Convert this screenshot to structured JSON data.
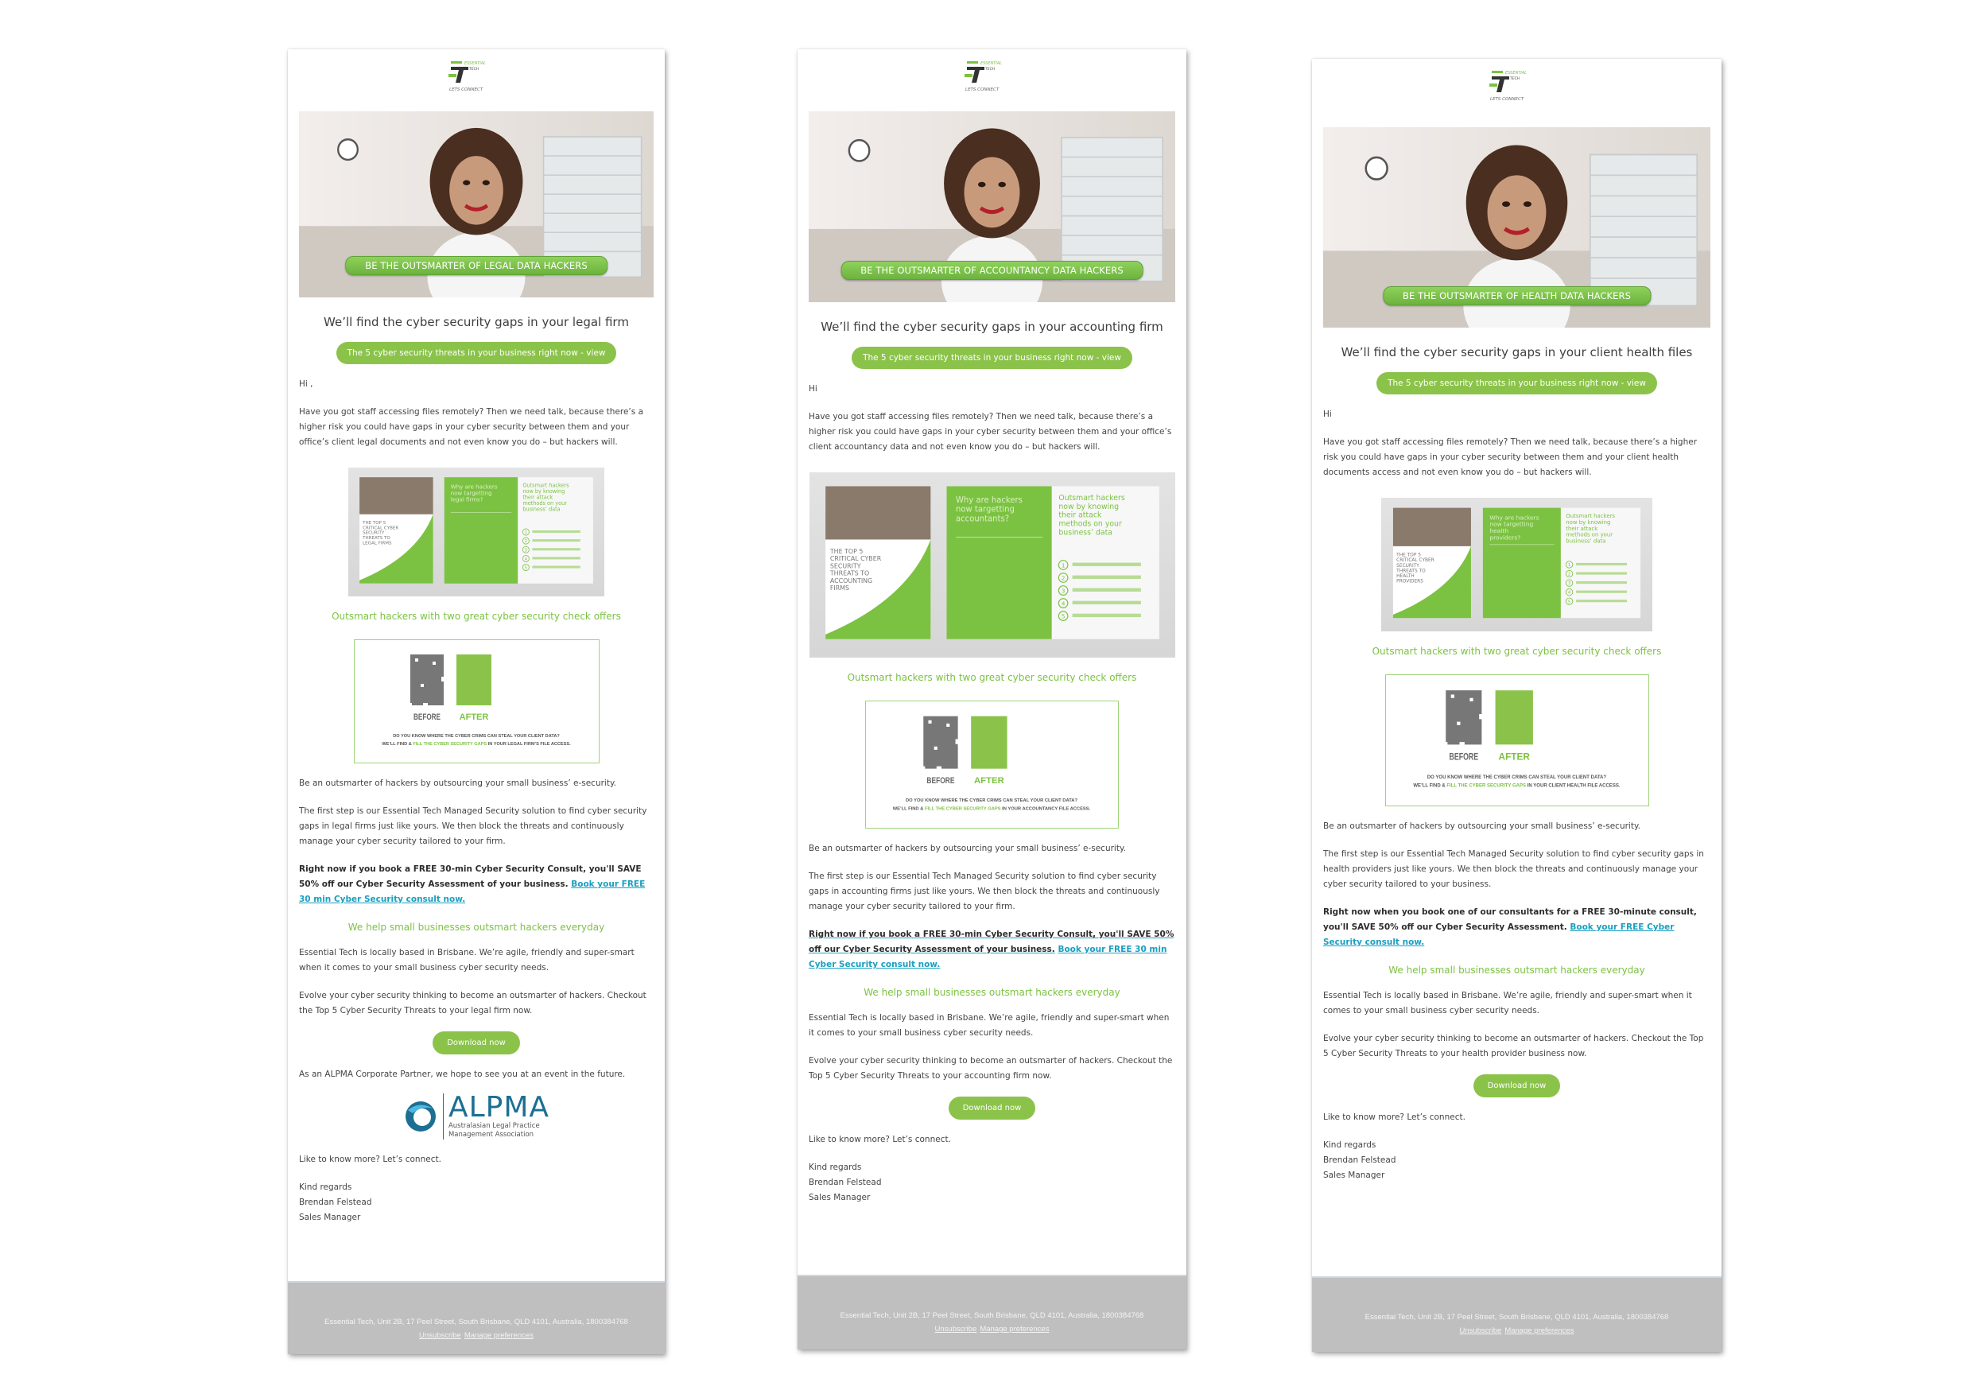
{
  "brand": {
    "logo_top": "ESSENTIAL",
    "logo_mid": "TECH",
    "logo_tag": "LETS CONNECT",
    "accent": "#8bc34a",
    "link_color": "#1a9fc0",
    "footer_bg": "#bfbfbf"
  },
  "emails": [
    {
      "variant": "legal",
      "hero_banner": "BE THE OUTSMARTER OF LEGAL DATA HACKERS",
      "headline": "We’ll find the cyber security gaps in your legal firm",
      "threats_button": "The 5 cyber security threats in your business right now - view",
      "greeting": "Hi ,",
      "intro": "Have you got staff accessing files remotely? Then we need talk, because there’s a higher risk you could have gaps in your cyber security between them and your office’s client legal documents and not even know you do – but hackers will.",
      "mockup": {
        "cover_title": "THE TOP 5 CRITICAL CYBER SECURITY THREATS TO LEGAL FIRMS",
        "page2_title": "Why are hackers now targetting legal firms?",
        "page3_title": "Outsmart hackers now by knowing their attack methods on your business’ data",
        "steps": [
          "1",
          "2",
          "3",
          "4",
          "5"
        ]
      },
      "offers_heading": "Outsmart hackers with two great cyber security check offers",
      "before_after": {
        "before_label": "BEFORE",
        "after_label": "AFTER",
        "line1": "DO YOU KNOW WHERE THE CYBER CRIMS CAN STEAL YOUR CLIENT DATA?",
        "line2_pre": "WE’LL FIND &",
        "line2_highlight": "FILL THE CYBER SECURITY GAPS",
        "line2_post": "IN YOUR LEGAL FIRM’S FILE ACCESS."
      },
      "outsource": "Be an outsmarter of hackers by outsourcing your small business’ e-security.",
      "first_step": "The first step is our Essential Tech Managed Security solution to find cyber security gaps in legal firms just like yours. We then block the threats and continuously manage your cyber security tailored to your firm.",
      "offer_bold": "Right now if you book a FREE 30-min Cyber Security Consult, you'll SAVE 50% off our Cyber Security Assessment of your business.",
      "offer_link": "Book your FREE 30 min Cyber Security consult now.",
      "help_heading": "We help small businesses outsmart hackers everyday",
      "local": "Essential Tech is locally based in Brisbane. We’re agile, friendly and super-smart when it comes to your small business cyber security needs.",
      "evolve": "Evolve your cyber security thinking to become an outsmarter of hackers. Checkout the Top 5 Cyber Security Threats to your legal firm now.",
      "download_button": "Download now",
      "partner": "As an ALPMA Corporate Partner, we hope to see you at an event in the future.",
      "alpma": {
        "name": "ALPMA",
        "line1": "Australasian Legal Practice",
        "line2": "Management Association"
      },
      "connect": "Like to know more? Let’s connect.",
      "signoff": "Kind regards",
      "sender_name": "Brendan Felstead",
      "sender_title": "Sales Manager",
      "footer": {
        "address": "Essential Tech, Unit 2B, 17 Peel Street, South Brisbane, QLD 4101, Australia, 1800384768",
        "unsubscribe": "Unsubscribe",
        "manage": "Manage preferences"
      }
    },
    {
      "variant": "accounting",
      "hero_banner": "BE THE OUTSMARTER OF ACCOUNTANCY DATA HACKERS",
      "headline": "We’ll find the cyber security gaps in your accounting firm",
      "threats_button": "The 5 cyber security threats in your business right now - view",
      "greeting": "Hi",
      "intro": "Have you got staff accessing files remotely? Then we need talk, because there’s a higher risk you could have gaps in your cyber security between them and your office’s client accountancy data and not even know you do – but hackers will.",
      "mockup": {
        "cover_title": "THE TOP 5 CRITICAL CYBER SECURITY THREATS TO ACCOUNTING FIRMS",
        "page2_title": "Why are hackers now targetting accountants?",
        "page3_title": "Outsmart hackers now by knowing their attack methods on your business’ data",
        "steps": [
          "1",
          "2",
          "3",
          "4",
          "5"
        ]
      },
      "offers_heading": "Outsmart hackers with two great cyber security check offers",
      "before_after": {
        "before_label": "BEFORE",
        "after_label": "AFTER",
        "line1": "DO YOU KNOW WHERE THE CYBER CRIMS CAN STEAL YOUR CLIENT DATA?",
        "line2_pre": "WE’LL FIND &",
        "line2_highlight": "FILL THE CYBER SECURITY GAPS",
        "line2_post": "IN YOUR ACCOUNTANCY FILE ACCESS."
      },
      "outsource": "Be an outsmarter of hackers by outsourcing your small business’ e-security.",
      "first_step": "The first step is our Essential Tech Managed Security solution to find cyber security gaps in accounting firms just like yours. We then block the threats and continuously manage your cyber security tailored to your firm.",
      "offer_bold": "Right now if you book a FREE 30-min Cyber Security Consult, you'll SAVE 50% off our Cyber Security Assessment of your business.",
      "offer_link": "Book your FREE 30 min Cyber Security consult now.",
      "help_heading": "We help small businesses outsmart hackers everyday",
      "local": "Essential Tech is locally based in Brisbane. We’re agile, friendly and super-smart when it comes to your small business cyber security needs.",
      "evolve": "Evolve your cyber security thinking to become an outsmarter of hackers. Checkout the Top 5 Cyber Security Threats to your accounting firm now.",
      "download_button": "Download now",
      "connect": "Like to know more? Let’s connect.",
      "signoff": "Kind regards",
      "sender_name": "Brendan Felstead",
      "sender_title": "Sales Manager",
      "footer": {
        "address": "Essential Tech, Unit 2B, 17 Peel Street, South Brisbane, QLD 4101, Australia, 1800384768",
        "unsubscribe": "Unsubscribe",
        "manage": "Manage preferences"
      }
    },
    {
      "variant": "health",
      "hero_banner": "BE THE OUTSMARTER OF HEALTH DATA HACKERS",
      "headline": "We’ll find the cyber security gaps in your client health files",
      "threats_button": "The 5 cyber security threats in your business right now - view",
      "greeting": "Hi",
      "intro": "Have you got staff accessing files remotely? Then we need talk, because there’s a higher risk you could have gaps in your cyber security between them and your client health documents access and not even know you do – but hackers will.",
      "mockup": {
        "cover_title": "THE TOP 5 CRITICAL CYBER SECURITY THREATS TO HEALTH PROVIDERS",
        "page2_title": "Why are hackers now targetting health providers?",
        "page3_title": "Outsmart hackers now by knowing their attack methods on your business’ data",
        "steps": [
          "1",
          "2",
          "3",
          "4",
          "5"
        ]
      },
      "offers_heading": "Outsmart hackers with two great cyber security check offers",
      "before_after": {
        "before_label": "BEFORE",
        "after_label": "AFTER",
        "line1": "DO YOU KNOW WHERE THE CYBER CRIMS CAN STEAL YOUR CLIENT DATA?",
        "line2_pre": "WE’LL FIND &",
        "line2_highlight": "FILL THE CYBER SECURITY GAPS",
        "line2_post": "IN YOUR CLIENT HEALTH FILE ACCESS."
      },
      "outsource": "Be an outsmarter of hackers by outsourcing your small business’ e-security.",
      "first_step": "The first step is our Essential Tech Managed Security solution to find cyber security gaps in health providers just like yours. We then block the threats and continuously manage your cyber security tailored to your business.",
      "offer_bold": "Right now when you book one of our consultants for a FREE 30-minute consult, you'll SAVE 50% off our Cyber Security Assessment.",
      "offer_link": "Book your FREE Cyber Security consult now.",
      "help_heading": "We help small businesses outsmart hackers everyday",
      "local": "Essential Tech is locally based in Brisbane. We’re agile, friendly and super-smart when it comes to your small business cyber security needs.",
      "evolve": "Evolve your cyber security thinking to become an outsmarter of hackers. Checkout the Top 5 Cyber Security Threats to your health provider business now.",
      "download_button": "Download now",
      "connect": "Like to know more? Let’s connect.",
      "signoff": "Kind regards",
      "sender_name": "Brendan Felstead",
      "sender_title": "Sales Manager",
      "footer": {
        "address": "Essential Tech, Unit 2B, 17 Peel Street, South Brisbane, QLD 4101, Australia, 1800384768",
        "unsubscribe": "Unsubscribe",
        "manage": "Manage preferences"
      }
    }
  ]
}
